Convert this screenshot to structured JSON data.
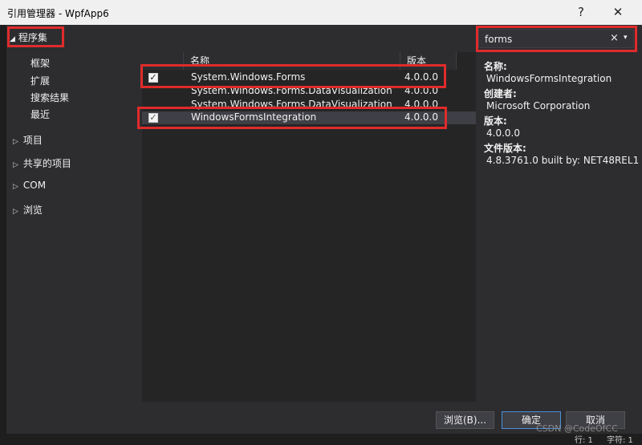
{
  "window": {
    "title": "引用管理器 - WpfApp6",
    "help_label": "?",
    "close_label": "✕"
  },
  "left_panel": {
    "section_title": "程序集",
    "sub_items": [
      "框架",
      "扩展",
      "搜索结果",
      "最近"
    ],
    "nodes": [
      "项目",
      "共享的项目",
      "COM",
      "浏览"
    ]
  },
  "list": {
    "columns": [
      "名称",
      "版本"
    ],
    "rows": [
      {
        "name": "System.Windows.Forms",
        "version": "4.0.0.0",
        "checked": true
      },
      {
        "name": "System.Windows.Forms.DataVisualization",
        "version": "4.0.0.0",
        "checked": false
      },
      {
        "name": "System.Windows.Forms.DataVisualization",
        "version": "4.0.0.0",
        "checked": false
      },
      {
        "name": "WindowsFormsIntegration",
        "version": "4.0.0.0",
        "checked": true
      }
    ]
  },
  "search": {
    "value": "forms",
    "clear_label": "×",
    "dropdown_label": "▾"
  },
  "details": {
    "name_label": "名称:",
    "name_value": "WindowsFormsIntegration",
    "creator_label": "创建者:",
    "creator_value": "Microsoft Corporation",
    "version_label": "版本:",
    "version_value": "4.0.0.0",
    "file_version_label": "文件版本:",
    "file_version_value": "4.8.3761.0 built by: NET48REL1"
  },
  "buttons": {
    "browse": "浏览(B)...",
    "ok": "确定",
    "cancel": "取消"
  },
  "watermark": "CSDN @CodeOfCC",
  "status": {
    "line": "行: 1",
    "char": "字符: 1"
  },
  "colors": {
    "highlight": "#e02b2b",
    "background": "#2d2d30"
  }
}
